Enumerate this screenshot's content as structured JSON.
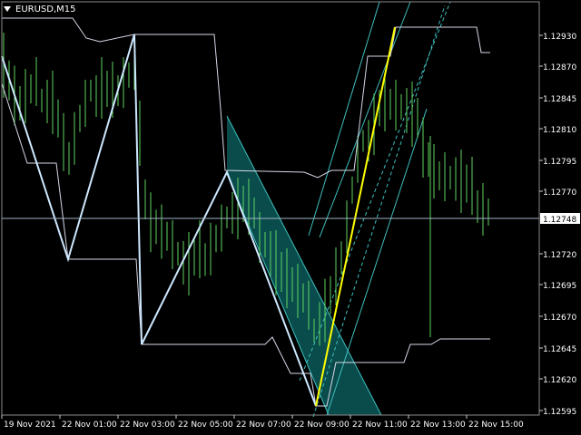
{
  "chart_data": {
    "type": "line",
    "symbol_label": "EURUSD,M15",
    "current_price_label": "1.12748",
    "current_price": 1.12748,
    "y_ticks": [
      "1.12930",
      "1.12870",
      "1.12845",
      "1.12810",
      "1.12795",
      "1.12770",
      "1.12720",
      "1.12695",
      "1.12670",
      "1.12645",
      "1.12620",
      "1.12595"
    ],
    "y_tick_values": [
      1.1293,
      1.1287,
      1.12845,
      1.1281,
      1.12795,
      1.1277,
      1.1272,
      1.12695,
      1.1267,
      1.12645,
      1.1262,
      1.12595
    ],
    "x_ticks": [
      "19 Nov 2021",
      "22 Nov 01:00",
      "22 Nov 03:00",
      "22 Nov 05:00",
      "22 Nov 07:00",
      "22 Nov 09:00",
      "22 Nov 11:00",
      "22 Nov 13:00",
      "22 Nov 15:00"
    ],
    "colors": {
      "background": "#000000",
      "bars": "#5fd35f",
      "envelope": "#d8d8e8",
      "zigzag": "#cde8ff",
      "channel": "#3fbfbf",
      "channel_fill": "#0b5050",
      "active_leg": "#ffff00",
      "price_line": "#9fb4c8",
      "axis_text": "#ffffff"
    }
  }
}
